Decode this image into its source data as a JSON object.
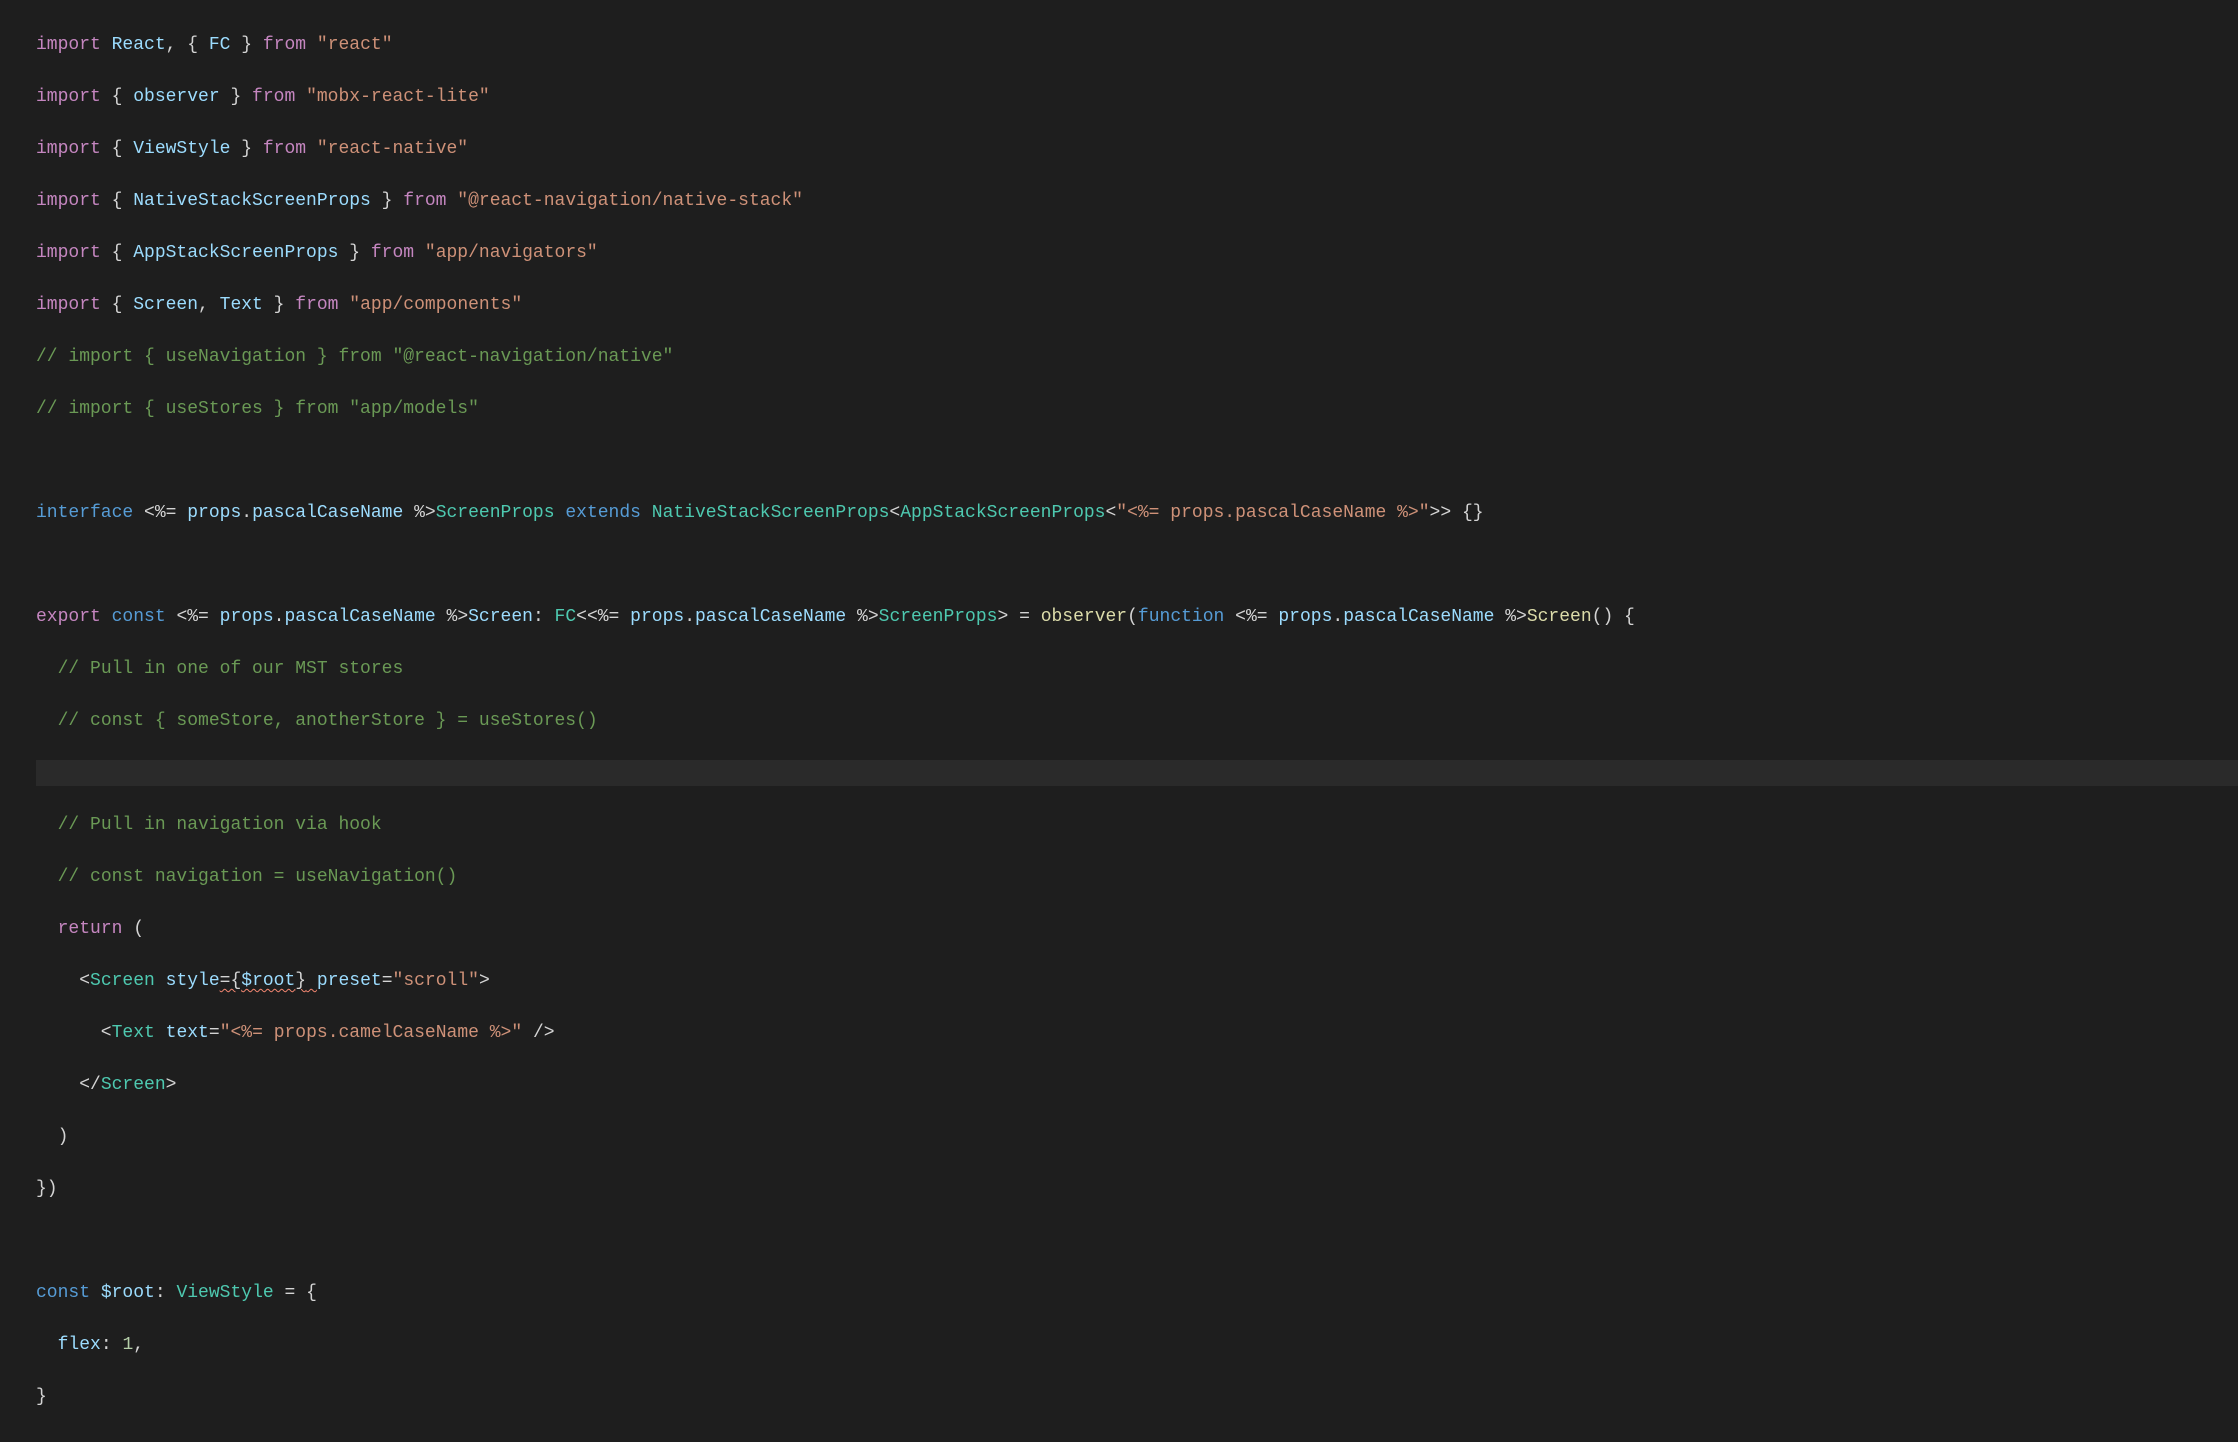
{
  "lines": {
    "l1": "import React, { FC } from \"react\"",
    "l2": "import { observer } from \"mobx-react-lite\"",
    "l3": "import { ViewStyle } from \"react-native\"",
    "l4": "import { NativeStackScreenProps } from \"@react-navigation/native-stack\"",
    "l5": "import { AppStackScreenProps } from \"app/navigators\"",
    "l6": "import { Screen, Text } from \"app/components\"",
    "l7": "// import { useNavigation } from \"@react-navigation/native\"",
    "l8": "// import { useStores } from \"app/models\"",
    "l9": "",
    "l10": "interface <%= props.pascalCaseName %>ScreenProps extends NativeStackScreenProps<AppStackScreenProps<\"<%= props.pascalCaseName %>\">> {}",
    "l11": "",
    "l12": "export const <%= props.pascalCaseName %>Screen: FC<<%= props.pascalCaseName %>ScreenProps> = observer(function <%= props.pascalCaseName %>Screen() {",
    "l13": "  // Pull in one of our MST stores",
    "l14": "  // const { someStore, anotherStore } = useStores()",
    "l15": "",
    "l16": "  // Pull in navigation via hook",
    "l17": "  // const navigation = useNavigation()",
    "l18": "  return (",
    "l19": "    <Screen style={$root} preset=\"scroll\">",
    "l20": "      <Text text=\"<%= props.camelCaseName %>\" />",
    "l21": "    </Screen>",
    "l22": "  )",
    "l23": "})",
    "l24": "",
    "l25": "const $root: ViewStyle = {",
    "l26": "  flex: 1,",
    "l27": "}"
  },
  "tokens": {
    "import": "import",
    "from": "from",
    "export": "export",
    "const": "const",
    "interface": "interface",
    "extends": "extends",
    "function": "function",
    "return": "return",
    "React": "React",
    "FC": "FC",
    "observer": "observer",
    "ViewStyle": "ViewStyle",
    "NativeStackScreenProps": "NativeStackScreenProps",
    "AppStackScreenProps": "AppStackScreenProps",
    "Screen": "Screen",
    "Text": "Text",
    "props": "props",
    "pascalCaseName": "pascalCaseName",
    "camelCaseName": "camelCaseName",
    "ScreenProps": "ScreenProps",
    "ScreenSuffix": "Screen",
    "style": "style",
    "preset": "preset",
    "text": "text",
    "root": "$root",
    "flex": "flex",
    "one": "1"
  },
  "strings": {
    "react": "\"react\"",
    "mobx": "\"mobx-react-lite\"",
    "rn": "\"react-native\"",
    "nativestack": "\"@react-navigation/native-stack\"",
    "navigators": "\"app/navigators\"",
    "components": "\"app/components\"",
    "scroll": "\"scroll\"",
    "q1": "\"",
    "q2": "\""
  },
  "comments": {
    "c1": "// import { useNavigation } from \"@react-navigation/native\"",
    "c2": "// import { useStores } from \"app/models\"",
    "c3": "// Pull in one of our MST stores",
    "c4": "// const { someStore, anotherStore } = useStores()",
    "c5": "// Pull in navigation via hook",
    "c6": "// const navigation = useNavigation()"
  }
}
